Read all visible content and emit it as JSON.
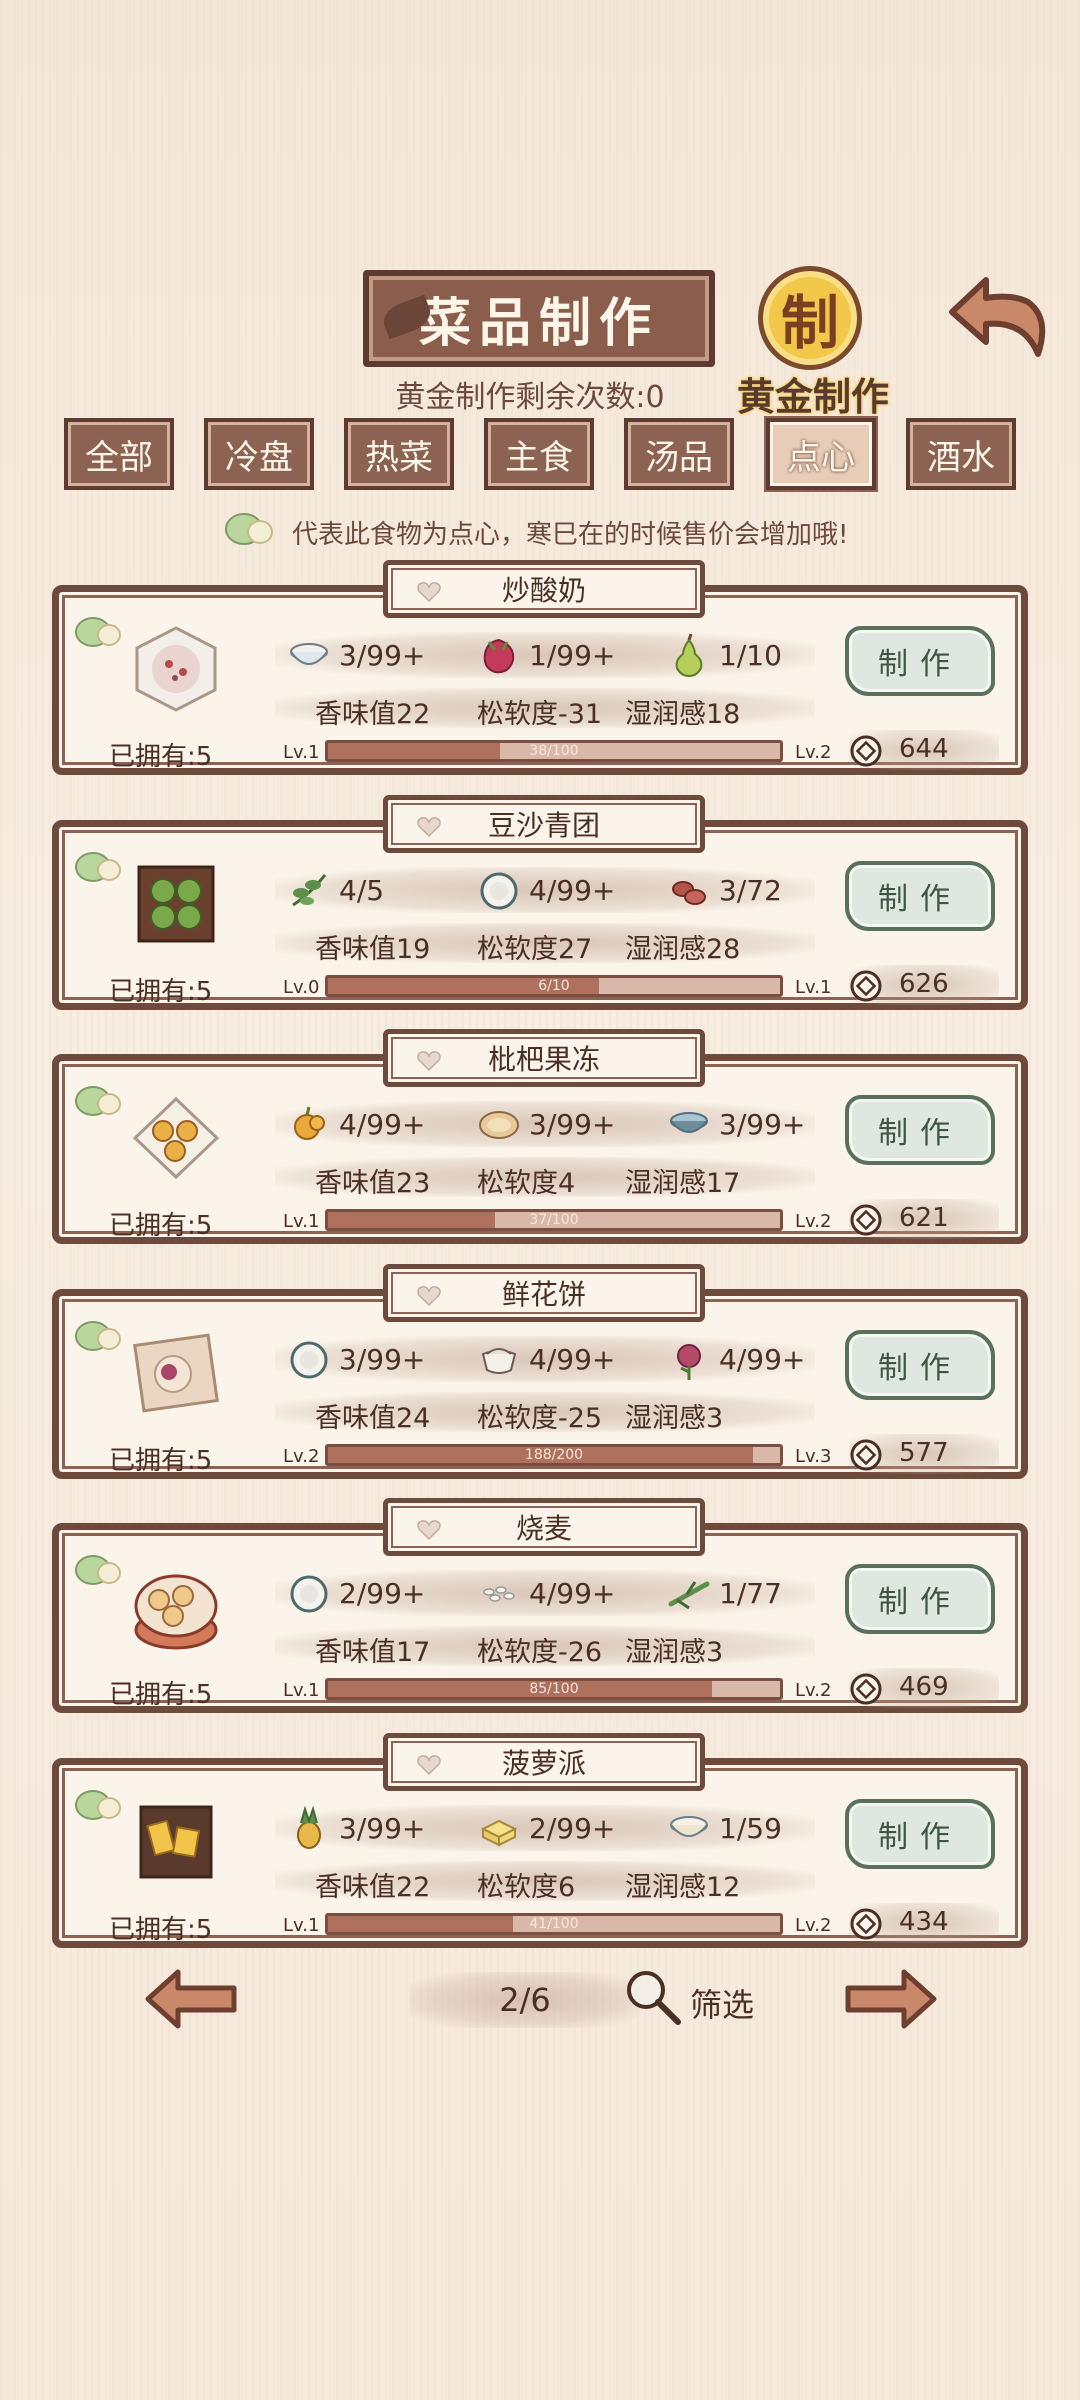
{
  "header": {
    "title": "菜品制作",
    "gold_seal_char": "制",
    "gold_label": "黄金制作",
    "remaining": "黄金制作剩余次数:0"
  },
  "tabs": [
    {
      "label": "全部",
      "active": false
    },
    {
      "label": "冷盘",
      "active": false
    },
    {
      "label": "热菜",
      "active": false
    },
    {
      "label": "主食",
      "active": false
    },
    {
      "label": "汤品",
      "active": false
    },
    {
      "label": "点心",
      "active": true
    },
    {
      "label": "酒水",
      "active": false
    }
  ],
  "hint": "代表此食物为点心，寒巳在的时候售价会增加哦!",
  "make_label": "制作",
  "recipes": [
    {
      "name": "炒酸奶",
      "owned": "已拥有:5",
      "ingredients": [
        {
          "icon": "rice-bowl-icon",
          "count": "3/99+"
        },
        {
          "icon": "dragonfruit-icon",
          "count": "1/99+"
        },
        {
          "icon": "pear-icon",
          "count": "1/10"
        }
      ],
      "stats": [
        "香味值22",
        "松软度-31",
        "湿润感18"
      ],
      "lv_left": "Lv.1",
      "lv_right": "Lv.2",
      "progress": "38/100",
      "progress_ratio": 0.38,
      "price": "644"
    },
    {
      "name": "豆沙青团",
      "owned": "已拥有:5",
      "ingredients": [
        {
          "icon": "herb-leaf-icon",
          "count": "4/5"
        },
        {
          "icon": "flour-bowl-icon",
          "count": "4/99+"
        },
        {
          "icon": "red-bean-icon",
          "count": "3/72"
        }
      ],
      "stats": [
        "香味值19",
        "松软度27",
        "湿润感28"
      ],
      "lv_left": "Lv.0",
      "lv_right": "Lv.1",
      "progress": "6/10",
      "progress_ratio": 0.6,
      "price": "626"
    },
    {
      "name": "枇杷果冻",
      "owned": "已拥有:5",
      "ingredients": [
        {
          "icon": "loquat-icon",
          "count": "4/99+"
        },
        {
          "icon": "pie-crust-icon",
          "count": "3/99+"
        },
        {
          "icon": "water-bowl-icon",
          "count": "3/99+"
        }
      ],
      "stats": [
        "香味值23",
        "松软度4",
        "湿润感17"
      ],
      "lv_left": "Lv.1",
      "lv_right": "Lv.2",
      "progress": "37/100",
      "progress_ratio": 0.37,
      "price": "621"
    },
    {
      "name": "鲜花饼",
      "owned": "已拥有:5",
      "ingredients": [
        {
          "icon": "flour-bowl-icon",
          "count": "3/99+"
        },
        {
          "icon": "sugar-bowl-icon",
          "count": "4/99+"
        },
        {
          "icon": "rose-icon",
          "count": "4/99+"
        }
      ],
      "stats": [
        "香味值24",
        "松软度-25",
        "湿润感3"
      ],
      "lv_left": "Lv.2",
      "lv_right": "Lv.3",
      "progress": "188/200",
      "progress_ratio": 0.94,
      "price": "577"
    },
    {
      "name": "烧麦",
      "owned": "已拥有:5",
      "ingredients": [
        {
          "icon": "flour-bowl-icon",
          "count": "2/99+"
        },
        {
          "icon": "rice-grains-icon",
          "count": "4/99+"
        },
        {
          "icon": "green-onion-icon",
          "count": "1/77"
        }
      ],
      "stats": [
        "香味值17",
        "松软度-26",
        "湿润感3"
      ],
      "lv_left": "Lv.1",
      "lv_right": "Lv.2",
      "progress": "85/100",
      "progress_ratio": 0.85,
      "price": "469"
    },
    {
      "name": "菠萝派",
      "owned": "已拥有:5",
      "ingredients": [
        {
          "icon": "pineapple-icon",
          "count": "3/99+"
        },
        {
          "icon": "butter-icon",
          "count": "2/99+"
        },
        {
          "icon": "milk-bowl-icon",
          "count": "1/59"
        }
      ],
      "stats": [
        "香味值22",
        "松软度6",
        "湿润感12"
      ],
      "lv_left": "Lv.1",
      "lv_right": "Lv.2",
      "progress": "41/100",
      "progress_ratio": 0.41,
      "price": "434"
    }
  ],
  "pager": {
    "page": "2/6",
    "filter_label": "筛选"
  },
  "colors": {
    "frame": "#6e4a3d",
    "tab": "#8c6352",
    "make_button": "#dfe8e0",
    "bar_fill": "#b0705e",
    "gold": "#f2c84a"
  }
}
